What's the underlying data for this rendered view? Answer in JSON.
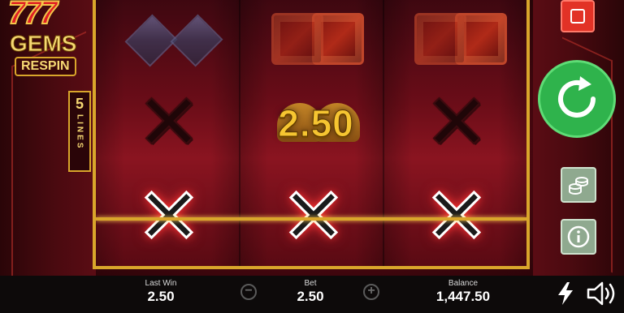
{
  "game": {
    "logo": {
      "digits": "777",
      "word1": "GEMS",
      "word2": "RESPIN"
    },
    "lines_badge": {
      "number": "5",
      "label": "LINES"
    },
    "win_display": "2.50"
  },
  "reels": [
    {
      "name": "reel-1",
      "symbols": [
        "purple-gem",
        "x",
        "x-win"
      ]
    },
    {
      "name": "reel-2",
      "symbols": [
        "red-gem",
        "bell",
        "x-win"
      ]
    },
    {
      "name": "reel-3",
      "symbols": [
        "red-gem",
        "x",
        "x-win"
      ]
    }
  ],
  "bottom_bar": {
    "last_win_label": "Last Win",
    "last_win_value": "2.50",
    "bet_label": "Bet",
    "bet_value": "2.50",
    "balance_label": "Balance",
    "balance_value": "1,447.50",
    "minus_symbol": "−",
    "plus_symbol": "+"
  },
  "controls": {
    "stop": "stop-icon",
    "spin": "spin-icon",
    "bet_settings": "coins-icon",
    "info": "info-icon",
    "turbo": "lightning-icon",
    "sound": "speaker-icon"
  },
  "colors": {
    "frame_gold": "#d9a62b",
    "spin_green": "#2fb34c",
    "stop_red": "#e23226",
    "win_gold": "#f6c531"
  }
}
